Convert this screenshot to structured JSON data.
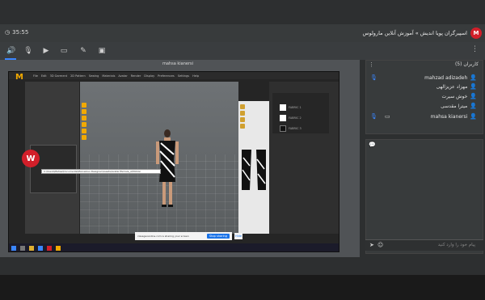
{
  "header": {
    "clock": "35:55",
    "title": "اسپیرگران پویا اندیش » آموزش آنلاین مارولوس",
    "logo_text": "M"
  },
  "toolbar": {
    "icons": [
      "speaker-icon",
      "mic-off-icon",
      "camera-icon",
      "screen-icon",
      "brush-icon",
      "presentation-icon"
    ]
  },
  "share": {
    "presenter_label": "mahsa kianersi"
  },
  "app_screen": {
    "logo_letter": "M",
    "menu": [
      "File",
      "Edit",
      "3D Garment",
      "2D Pattern",
      "Sewing",
      "Materials",
      "Avatar",
      "Render",
      "Display",
      "Preferences",
      "Settings",
      "Help"
    ],
    "fabrics": [
      "FABRIC 1",
      "FABRIC 2",
      "FABRIC 3"
    ],
    "file_path": "C:\\Users\\Mahsa\\Documents\\Marvelous Designer\\Assets\\Avatar\\Female_A\\Motion",
    "share_message": "classgeoanline.com is sharing your screen",
    "stop_label": "Stop sharing",
    "hide_label": "Hide",
    "watermark_text": "W"
  },
  "users_panel": {
    "title": "کاربران (5)",
    "users": [
      {
        "name": "mahzad adizadeh"
      },
      {
        "name": "مهزاد عزیزالهی"
      },
      {
        "name": "خوش سیرت"
      },
      {
        "name": "میترا مقدسی"
      },
      {
        "name": "mahsa kianersi"
      }
    ]
  },
  "chat": {
    "placeholder": "پیام خود را وارد کنید"
  },
  "colors": {
    "accent": "#3a86ff",
    "brand": "#d21f2a",
    "md_orange": "#f2a900"
  }
}
